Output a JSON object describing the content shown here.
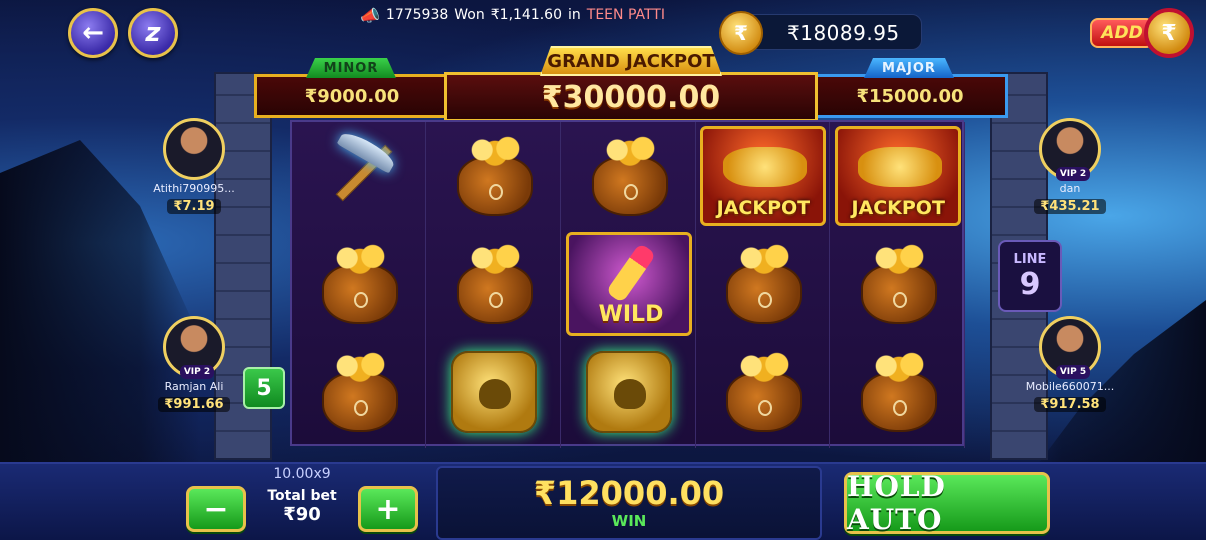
{
  "ticker": {
    "user_id": "1775938",
    "won_text": "Won",
    "amount": "₹1,141.60",
    "in_text": "in",
    "game": "TEEN PATTI"
  },
  "balance": {
    "coin": "₹",
    "value": "₹18089.95"
  },
  "add": {
    "label": "ADD",
    "coin": "₹"
  },
  "jackpots": {
    "minor": {
      "label": "MINOR",
      "value": "₹9000.00"
    },
    "grand": {
      "label": "GRAND JACKPOT",
      "value": "₹30000.00"
    },
    "major": {
      "label": "MAJOR",
      "value": "₹15000.00"
    }
  },
  "reels": [
    [
      "pickaxe",
      "coin-bag",
      "coin-bag"
    ],
    [
      "coin-bag",
      "coin-bag",
      "skull-coin"
    ],
    [
      "coin-bag",
      "wild",
      "skull-coin"
    ],
    [
      "jackpot-chest",
      "coin-bag",
      "coin-bag"
    ],
    [
      "jackpot-chest",
      "coin-bag",
      "coin-bag"
    ]
  ],
  "symbol_labels": {
    "jackpot": "JACKPOT",
    "wild": "WILD"
  },
  "players": {
    "left_top": {
      "name": "Atithi790995...",
      "amount": "₹7.19"
    },
    "left_bottom": {
      "vip": "VIP 2",
      "name": "Ramjan Ali",
      "amount": "₹991.66"
    },
    "right_top": {
      "vip": "VIP 2",
      "name": "dan",
      "amount": "₹435.21"
    },
    "right_bottom": {
      "vip": "VIP 5",
      "name": "Mobile660071...",
      "amount": "₹917.58"
    }
  },
  "line": {
    "label": "LINE",
    "value": "9"
  },
  "lines_badge": "5",
  "bet": {
    "multiplier": "10.00x9",
    "label": "Total bet",
    "value": "₹90",
    "minus": "−",
    "plus": "+"
  },
  "win": {
    "amount": "₹12000.00",
    "label": "WIN"
  },
  "hold_auto": "HOLD AUTO",
  "icons": {
    "back": "←",
    "info": "z"
  }
}
